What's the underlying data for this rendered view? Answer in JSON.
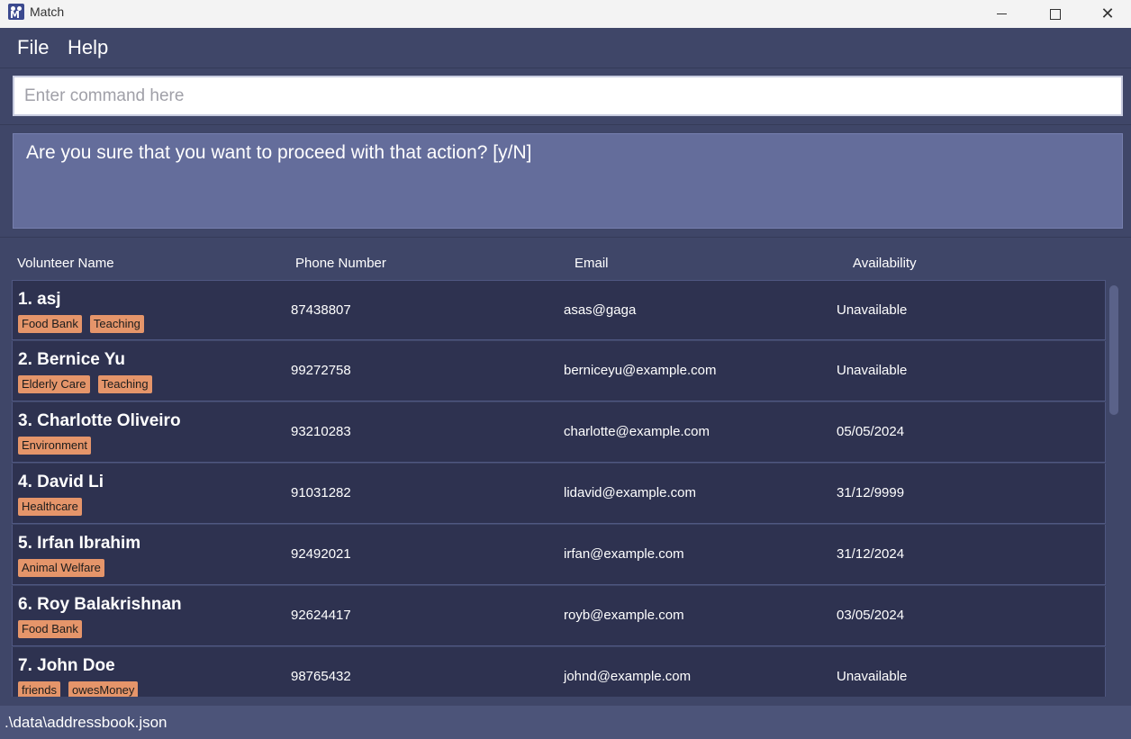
{
  "window": {
    "title": "Match"
  },
  "menu": {
    "file": "File",
    "help": "Help"
  },
  "command": {
    "placeholder": "Enter command here",
    "value": ""
  },
  "result": {
    "message": "Are you sure that you want to proceed with that action? [y/N]"
  },
  "list": {
    "headers": {
      "name": "Volunteer Name",
      "phone": "Phone Number",
      "email": "Email",
      "availability": "Availability"
    },
    "items": [
      {
        "name": "1. asj",
        "tags": [
          "Food Bank",
          "Teaching"
        ],
        "phone": "87438807",
        "email": "asas@gaga",
        "availability": "Unavailable"
      },
      {
        "name": "2. Bernice Yu",
        "tags": [
          "Elderly Care",
          "Teaching"
        ],
        "phone": "99272758",
        "email": "berniceyu@example.com",
        "availability": "Unavailable"
      },
      {
        "name": "3. Charlotte Oliveiro",
        "tags": [
          "Environment"
        ],
        "phone": "93210283",
        "email": "charlotte@example.com",
        "availability": "05/05/2024"
      },
      {
        "name": "4. David Li",
        "tags": [
          "Healthcare"
        ],
        "phone": "91031282",
        "email": "lidavid@example.com",
        "availability": "31/12/9999"
      },
      {
        "name": "5. Irfan Ibrahim",
        "tags": [
          "Animal Welfare"
        ],
        "phone": "92492021",
        "email": "irfan@example.com",
        "availability": "31/12/2024"
      },
      {
        "name": "6. Roy Balakrishnan",
        "tags": [
          "Food Bank"
        ],
        "phone": "92624417",
        "email": "royb@example.com",
        "availability": "03/05/2024"
      },
      {
        "name": "7. John Doe",
        "tags": [
          "friends",
          "owesMoney"
        ],
        "phone": "98765432",
        "email": "johnd@example.com",
        "availability": "Unavailable"
      }
    ]
  },
  "status": {
    "file_path": ".\\data\\addressbook.json"
  },
  "colors": {
    "background": "#3f4668",
    "card": "#2e3250",
    "result_box": "#646d9b",
    "tag": "#e5956a"
  }
}
